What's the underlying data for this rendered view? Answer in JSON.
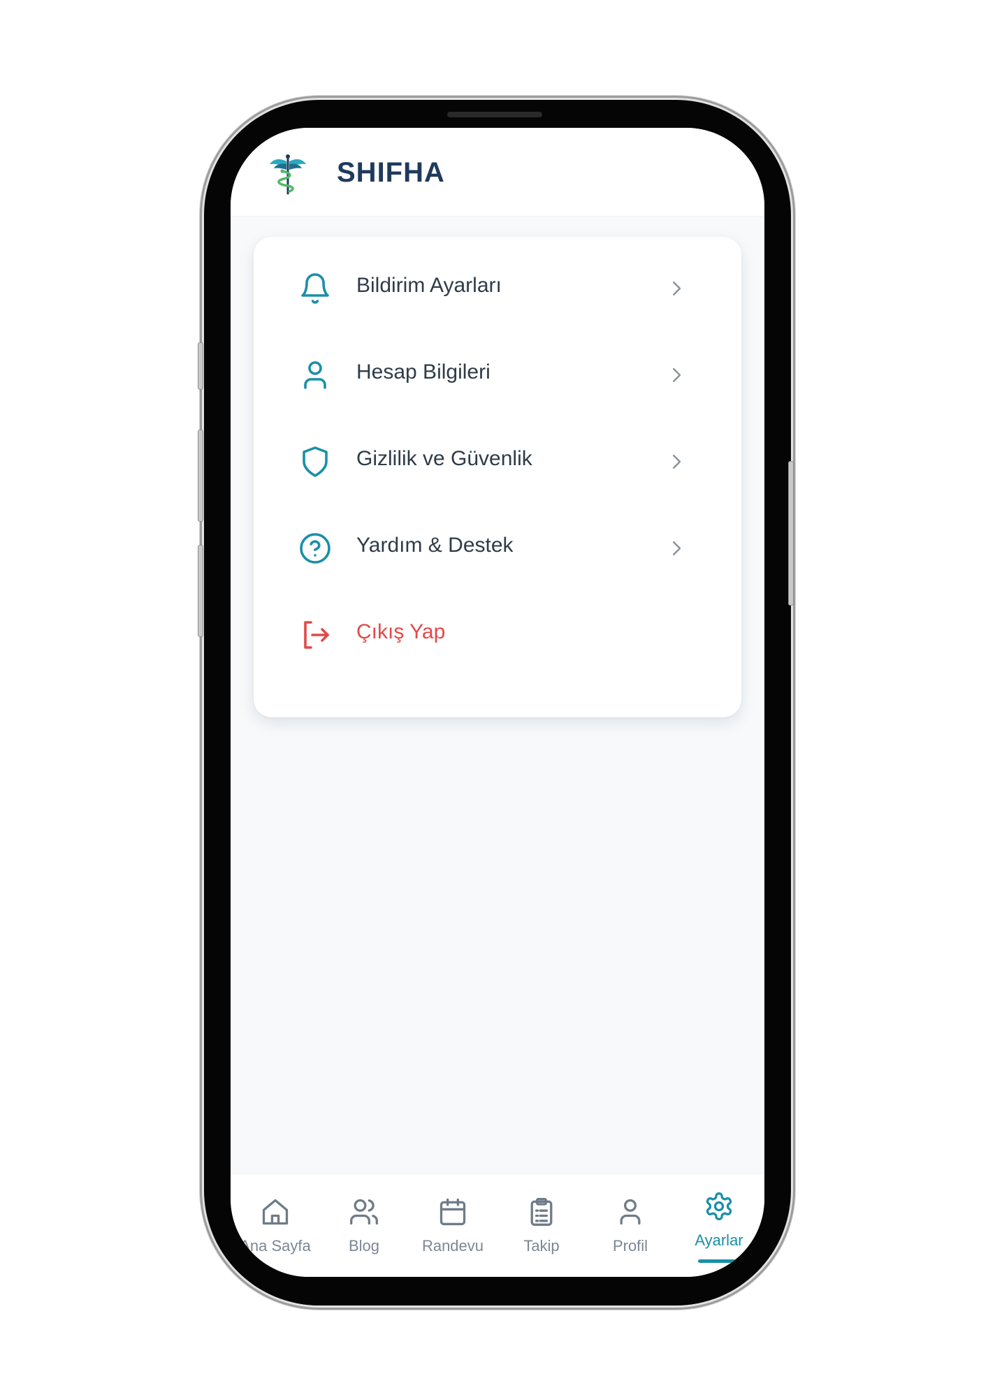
{
  "app": {
    "name": "SHIFHA"
  },
  "colors": {
    "accent": "#1a8fa8",
    "danger": "#e24a4a",
    "text": "#2f3b48",
    "muted": "#7b8794",
    "brand": "#1f3a5c"
  },
  "settings": {
    "items": [
      {
        "label": "Bildirim Ayarları",
        "icon": "bell-icon"
      },
      {
        "label": "Hesap Bilgileri",
        "icon": "user-icon"
      },
      {
        "label": "Gizlilik ve Güvenlik",
        "icon": "shield-icon"
      },
      {
        "label": "Yardım & Destek",
        "icon": "help-circle-icon"
      },
      {
        "label": "Çıkış Yap",
        "icon": "logout-icon"
      }
    ]
  },
  "tabbar": {
    "tabs": [
      {
        "label": "Ana Sayfa",
        "icon": "home-icon"
      },
      {
        "label": "Blog",
        "icon": "users-icon"
      },
      {
        "label": "Randevu",
        "icon": "calendar-icon"
      },
      {
        "label": "Takip",
        "icon": "clipboard-icon"
      },
      {
        "label": "Profil",
        "icon": "user-icon"
      },
      {
        "label": "Ayarlar",
        "icon": "gear-icon",
        "active": true
      }
    ]
  }
}
